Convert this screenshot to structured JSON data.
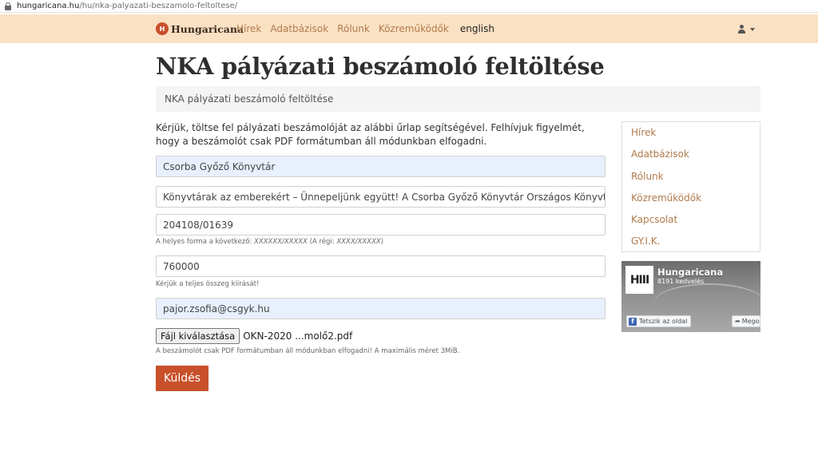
{
  "browser": {
    "url_host": "hungaricana.hu",
    "url_path": "/hu/nka-palyazati-beszamolo-feltoltese/"
  },
  "navbar": {
    "logo_letters": "H",
    "brand": "Hungaricana",
    "links": [
      "Hírek",
      "Adatbázisok",
      "Rólunk",
      "Közreműködők"
    ],
    "language": "english"
  },
  "page": {
    "title": "NKA pályázati beszámoló feltöltése",
    "breadcrumb": "NKA pályázati beszámoló feltöltése"
  },
  "form": {
    "intro": "Kérjük, töltse fel pályázati beszámolóját az alábbi űrlap segítségével. Felhívjuk figyelmét, hogy a beszámolót csak PDF formátumban áll módunkban elfogadni.",
    "organization": "Csorba Győző Könyvtár",
    "project_title": "Könyvtárak az emberekért – Ünnepeljünk együtt! A Csorba Győző Könyvtár Országos Könyvtári Napokhoz ka",
    "id_number": "204108/01639",
    "id_help_prefix": "A helyes forma a következő: ",
    "id_help_format": "XXXXXX/XXXXX",
    "id_help_old_prefix": " (A régi: ",
    "id_help_old_format": "XXXX/XXXXX",
    "id_help_suffix": ")",
    "amount": "760000",
    "amount_help": "Kérjük a teljes összeg kiírását!",
    "email": "pajor.zsofia@csgyk.hu",
    "file_button": "Fájl kiválasztása",
    "file_name": "OKN-2020 ...molő2.pdf",
    "file_help": "A beszámolót csak PDF formátumban áll módunkban elfogadni! A maximális méret 3MiB.",
    "submit": "Küldés"
  },
  "sidebar": {
    "items": [
      "Hírek",
      "Adatbázisok",
      "Rólunk",
      "Közreműködők",
      "Kapcsolat",
      "GY.I.K."
    ]
  },
  "facebook": {
    "logo_glyph": "HIII",
    "name": "Hungaricana",
    "likes": "8191 kedvelés",
    "like_button": "Tetszik az oldal",
    "share_button": "Megosztás"
  },
  "colors": {
    "navbar_bg": "#fbe1c3",
    "accent": "#c8502a",
    "link": "#b07a4c"
  }
}
